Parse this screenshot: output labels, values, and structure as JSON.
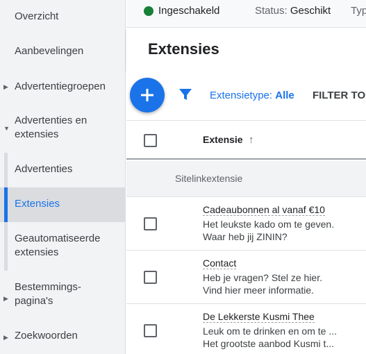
{
  "sidebar": {
    "items": [
      {
        "label": "Overzicht"
      },
      {
        "label": "Aanbevelingen"
      },
      {
        "label": "Advertentiegroepen"
      },
      {
        "label_line1": "Advertenties en",
        "label_line2": "extensies"
      },
      {
        "label": "Advertenties"
      },
      {
        "label": "Extensies"
      },
      {
        "label_line1": "Geautomatiseerde",
        "label_line2": "extensies"
      },
      {
        "label_line1": "Bestemmings-",
        "label_line2": "pagina's"
      },
      {
        "label": "Zoekwoorden"
      }
    ]
  },
  "status_strip": {
    "enabled": "Ingeschakeld",
    "status_label": "Status:",
    "status_value": "Geschikt",
    "type_label": "Typ"
  },
  "page": {
    "title": "Extensies"
  },
  "toolbar": {
    "filter_label": "Extensietype:",
    "filter_value": "Alle",
    "filter_toggle": "FILTER TO"
  },
  "table": {
    "column_extension": "Extensie",
    "sort_arrow": "↑",
    "group_label": "Sitelinkextensie",
    "rows": [
      {
        "title": "Cadeaubonnen al vanaf €10",
        "line1": "Het leukste kado om te geven.",
        "line2": "Waar heb jij ZININ?"
      },
      {
        "title": "Contact",
        "line1": "Heb je vragen? Stel ze hier.",
        "line2": "Vind hier meer informatie."
      },
      {
        "title": "De Lekkerste Kusmi Thee",
        "line1": "Leuk om te drinken en om te ...",
        "line2": "Het grootste aanbod Kusmi t..."
      }
    ]
  },
  "colors": {
    "accent": "#1a73e8",
    "status_green": "#188038"
  },
  "icons": {
    "add": "add-icon",
    "filter": "filter-icon",
    "status": "status-dot-icon"
  }
}
